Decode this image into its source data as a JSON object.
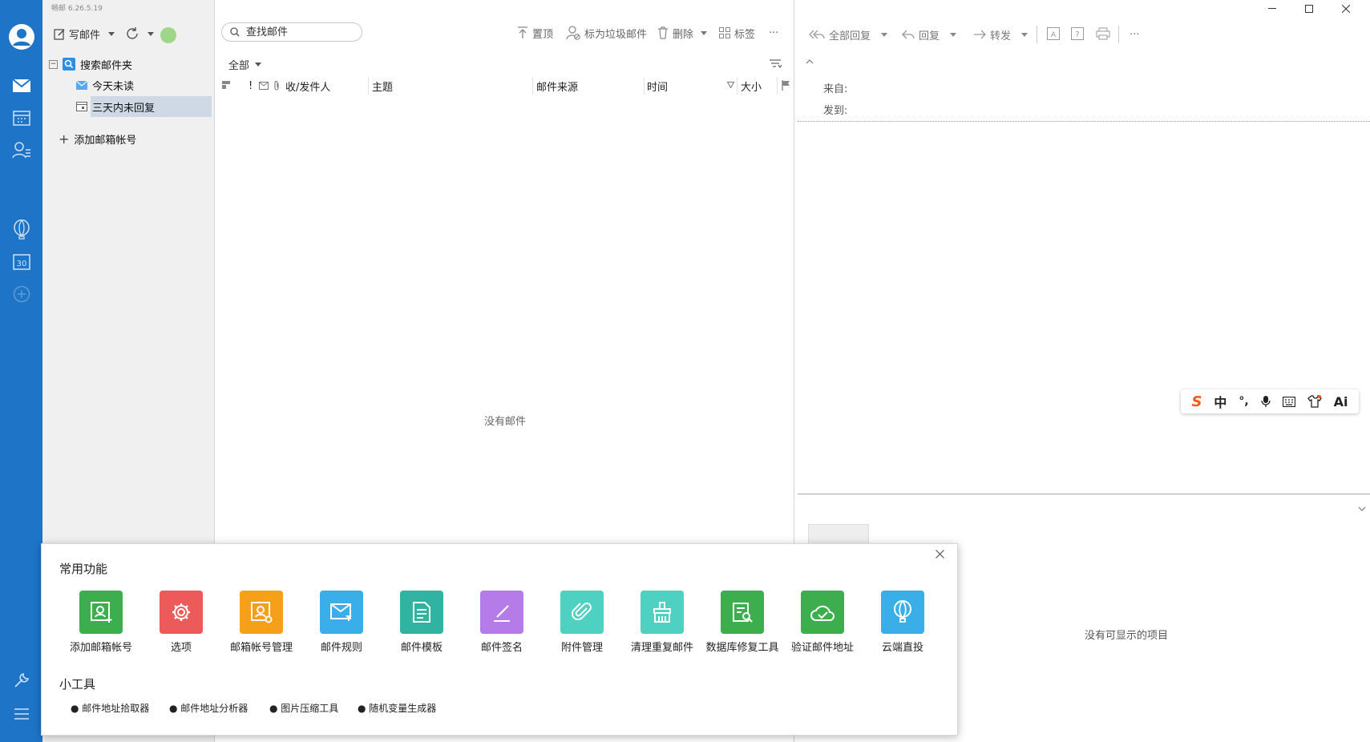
{
  "app": {
    "version": "畅邮 6.26.5.19"
  },
  "colors": {
    "rail": "#1e74c6",
    "selected_row": "#cfd9e6"
  },
  "rail": {
    "icons": [
      "avatar-icon",
      "mail-icon",
      "calendar-icon",
      "contacts-icon",
      "balloon-icon",
      "calendar-30-icon",
      "add-circle-icon",
      "wrench-icon",
      "menu-icon"
    ]
  },
  "folder_toolbar": {
    "compose_label": "写邮件"
  },
  "folders": {
    "search_folder": "搜索邮件夹",
    "items": [
      {
        "label": "今天未读"
      },
      {
        "label": "三天内未回复",
        "selected": true
      }
    ],
    "add_account": "添加邮箱帐号"
  },
  "list_toolbar": {
    "search_placeholder": "查找邮件",
    "pin": "置顶",
    "mark_spam": "标为垃圾邮件",
    "delete": "删除",
    "tag": "标签",
    "more": "···",
    "filter": "全部"
  },
  "columns": {
    "flag": "!",
    "sender": "收/发件人",
    "subject": "主题",
    "source": "邮件来源",
    "time": "时间",
    "size": "大小"
  },
  "list_empty": "没有邮件",
  "reading_toolbar": {
    "reply_all": "全部回复",
    "reply": "回复",
    "forward": "转发",
    "more": "···"
  },
  "reading": {
    "from_label": "来自:",
    "to_label": "发到:",
    "empty": "没有可显示的项目"
  },
  "ime": {
    "items": [
      "S",
      "中",
      "°,",
      "mic",
      "keyboard",
      "shirt",
      "Ai"
    ],
    "accent": "#f05a1a"
  },
  "popup": {
    "common_title": "常用功能",
    "tools": [
      {
        "label": "添加邮箱帐号",
        "color": "#3dae4e",
        "icon": "add-account-icon"
      },
      {
        "label": "选项",
        "color": "#ec5a5a",
        "icon": "gear-icon"
      },
      {
        "label": "邮箱帐号管理",
        "color": "#f6a01a",
        "icon": "account-manage-icon"
      },
      {
        "label": "邮件规则",
        "color": "#3aaee8",
        "icon": "mail-rule-icon"
      },
      {
        "label": "邮件模板",
        "color": "#30b3a1",
        "icon": "template-icon"
      },
      {
        "label": "邮件签名",
        "color": "#b57be8",
        "icon": "pen-icon"
      },
      {
        "label": "附件管理",
        "color": "#4fd1c1",
        "icon": "paperclip-icon"
      },
      {
        "label": "清理重复邮件",
        "color": "#4fd1c1",
        "icon": "broom-icon"
      },
      {
        "label": "数据库修复工具",
        "color": "#3dae4e",
        "icon": "db-repair-icon"
      },
      {
        "label": "验证邮件地址",
        "color": "#3dae4e",
        "icon": "cloud-check-icon"
      },
      {
        "label": "云端直投",
        "color": "#3aaee8",
        "icon": "balloon-icon"
      }
    ],
    "gadgets_title": "小工具",
    "gadgets": [
      "● 邮件地址拾取器",
      "● 邮件地址分析器",
      "● 图片压缩工具",
      "● 随机变量生成器"
    ]
  }
}
